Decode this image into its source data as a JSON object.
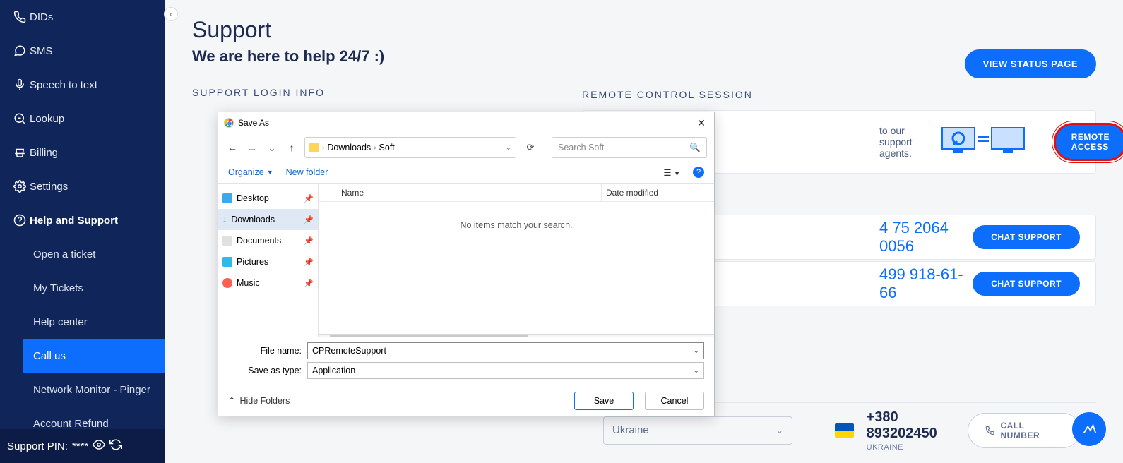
{
  "sidebar": {
    "items": [
      {
        "label": "DIDs"
      },
      {
        "label": "SMS"
      },
      {
        "label": "Speech to text"
      },
      {
        "label": "Lookup"
      },
      {
        "label": "Billing"
      },
      {
        "label": "Settings"
      },
      {
        "label": "Help and Support"
      }
    ],
    "subItems": [
      {
        "label": "Open a ticket"
      },
      {
        "label": "My Tickets"
      },
      {
        "label": "Help center"
      },
      {
        "label": "Call us"
      },
      {
        "label": "Network Monitor - Pinger"
      },
      {
        "label": "Account Refund"
      }
    ],
    "pinLabel": "Support PIN:",
    "pinMask": "****"
  },
  "page": {
    "title": "Support",
    "subtitle": "We are here to help 24/7 :)",
    "statusBtn": "VIEW STATUS PAGE",
    "supportLoginLabel": "SUPPORT LOGIN INFO",
    "remoteSessionLabel": "REMOTE CONTROL SESSION",
    "remoteText": "to our support agents.",
    "remoteBtn": "REMOTE ACCESS",
    "phone1": "4 75 2064 0056",
    "phone2": "499 918-61-66",
    "chatBtn": "CHAT SUPPORT",
    "country": {
      "select": "Ukraine",
      "name": "UKRAINE",
      "number": "+380 893202450",
      "callBtn": "CALL NUMBER"
    }
  },
  "dialog": {
    "title": "Save As",
    "breadcrumb": {
      "a": "Downloads",
      "b": "Soft"
    },
    "searchPlaceholder": "Search Soft",
    "organize": "Organize",
    "newFolder": "New folder",
    "colName": "Name",
    "colDate": "Date modified",
    "empty": "No items match your search.",
    "side": [
      {
        "label": "Desktop"
      },
      {
        "label": "Downloads"
      },
      {
        "label": "Documents"
      },
      {
        "label": "Pictures"
      },
      {
        "label": "Music"
      }
    ],
    "fileNameLabel": "File name:",
    "fileName": "CPRemoteSupport",
    "saveTypeLabel": "Save as type:",
    "saveType": "Application",
    "hideFolders": "Hide Folders",
    "save": "Save",
    "cancel": "Cancel"
  }
}
